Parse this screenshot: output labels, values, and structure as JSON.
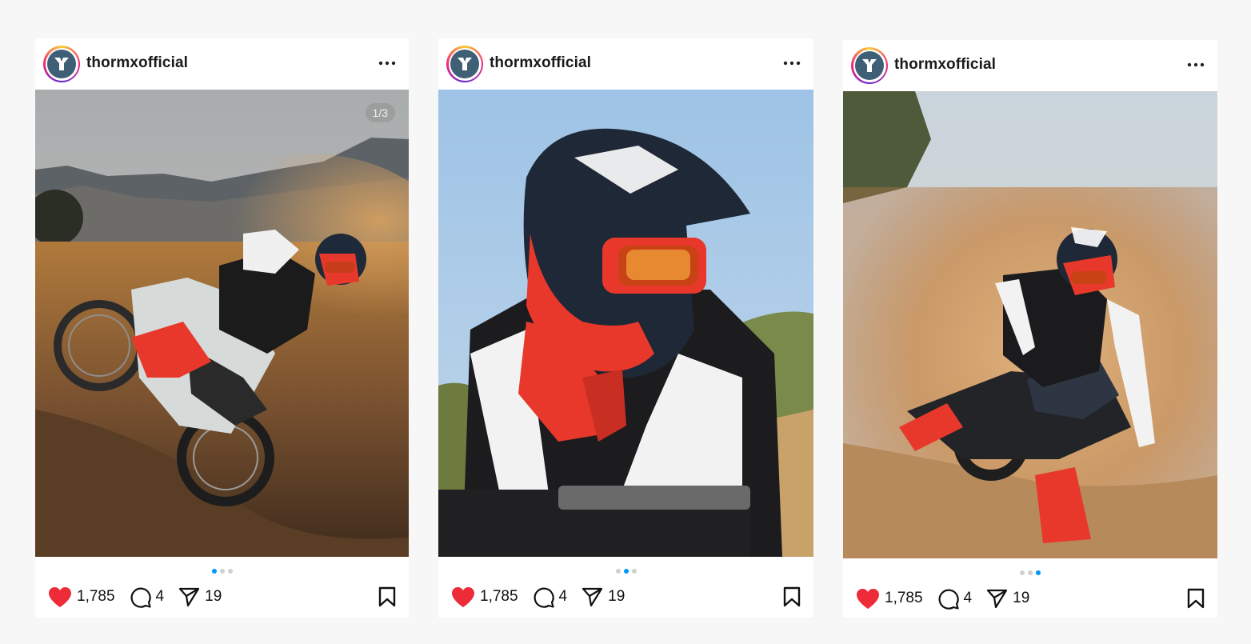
{
  "posts": [
    {
      "username": "thormxofficial",
      "photo_counter": "1/3",
      "active_slide": 0,
      "slides": 3,
      "likes": "1,785",
      "comments": "4",
      "shares": "19"
    },
    {
      "username": "thormxofficial",
      "active_slide": 1,
      "slides": 3,
      "likes": "1,785",
      "comments": "4",
      "shares": "19"
    },
    {
      "username": "thormxofficial",
      "active_slide": 2,
      "slides": 3,
      "likes": "1,785",
      "comments": "4",
      "shares": "19"
    }
  ],
  "colors": {
    "like": "#ed2b39",
    "active_dot": "#0095f6",
    "avatar_bg": "#3f5f76",
    "helmet_red": "#e8382b"
  },
  "icons": [
    "thor-logo-icon",
    "more-options-icon",
    "heart-icon",
    "comment-icon",
    "share-icon",
    "bookmark-icon"
  ]
}
